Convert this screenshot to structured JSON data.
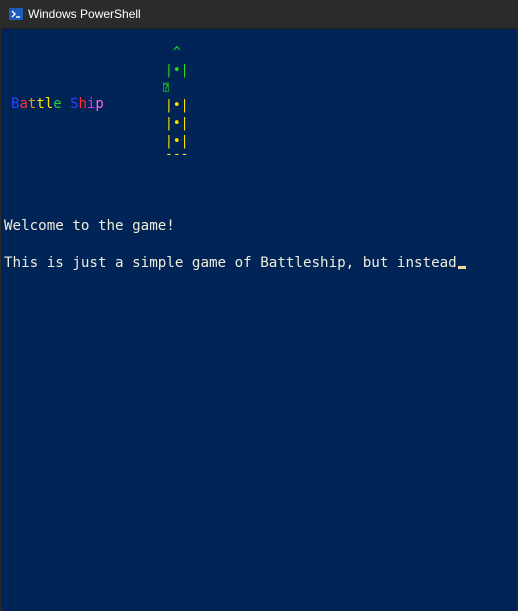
{
  "window": {
    "title": "Windows PowerShell"
  },
  "logo": {
    "letters": [
      {
        "ch": "B",
        "color": "#2244ff"
      },
      {
        "ch": "a",
        "color": "#ff3030"
      },
      {
        "ch": "t",
        "color": "#ff8c00"
      },
      {
        "ch": "t",
        "color": "#ffe000"
      },
      {
        "ch": "l",
        "color": "#ffe000"
      },
      {
        "ch": "e",
        "color": "#20d040"
      },
      {
        "ch": " ",
        "color": "#012456"
      },
      {
        "ch": "S",
        "color": "#2244ff"
      },
      {
        "ch": "h",
        "color": "#ff3030"
      },
      {
        "ch": "i",
        "color": "#cc33ff"
      },
      {
        "ch": "p",
        "color": "#ff66cc"
      }
    ]
  },
  "ship": {
    "lines": [
      {
        "text": " ^ ",
        "color": "#20e020"
      },
      {
        "text": "|•|",
        "color": "#20e020"
      },
      {
        "text": "⍰",
        "color": "#20e020"
      },
      {
        "text": "|•|",
        "color": "#ffe000"
      },
      {
        "text": "|•|",
        "color": "#ffe000"
      },
      {
        "text": "|•|",
        "color": "#ffe000"
      },
      {
        "text": "---",
        "color": "#ffe000"
      }
    ]
  },
  "console": {
    "line1": "Welcome to the game!",
    "line2": "This is just a simple game of Battleship, but instead"
  },
  "colors": {
    "background": "#012456",
    "titlebar": "#2b2b2b"
  }
}
